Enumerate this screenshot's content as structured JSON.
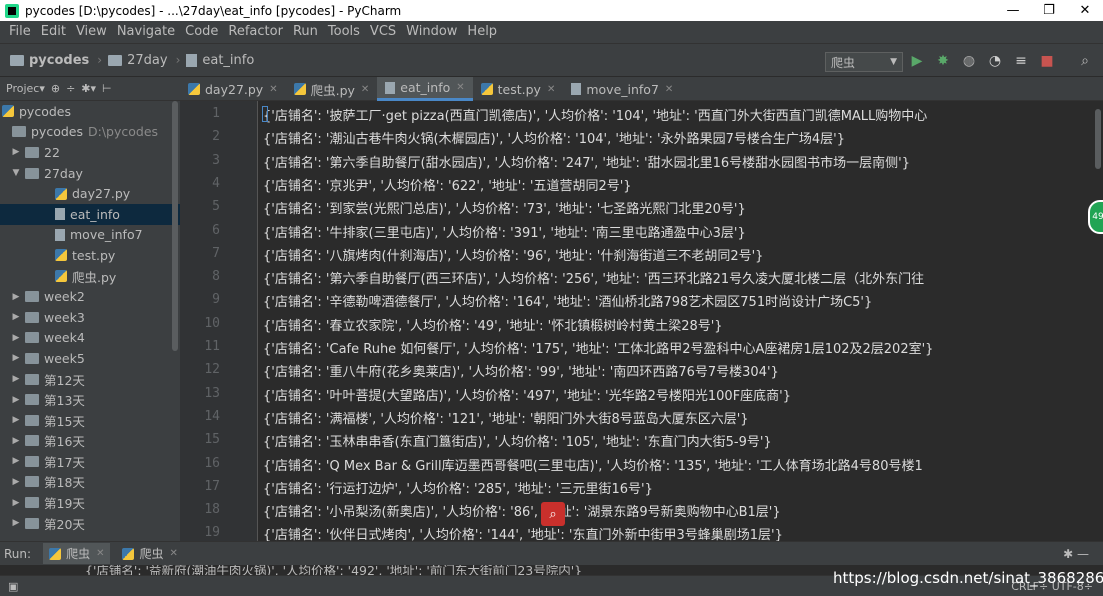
{
  "window": {
    "title": "pycodes [D:\\pycodes] - ...\\27day\\eat_info [pycodes] - PyCharm",
    "minimize": "—",
    "maximize": "❐",
    "close": "✕"
  },
  "menu": [
    "File",
    "Edit",
    "View",
    "Navigate",
    "Code",
    "Refactor",
    "Run",
    "Tools",
    "VCS",
    "Window",
    "Help"
  ],
  "breadcrumb": [
    "pycodes",
    "27day",
    "eat_info"
  ],
  "run_config": "爬虫",
  "project_toolbar": {
    "label": "Projec▾"
  },
  "tabs": [
    {
      "label": "day27.py",
      "icon": "python-file-icon",
      "active": false
    },
    {
      "label": "爬虫.py",
      "icon": "python-file-icon",
      "active": false
    },
    {
      "label": "eat_info",
      "icon": "text-file-icon",
      "active": true
    },
    {
      "label": "test.py",
      "icon": "python-file-icon",
      "active": false
    },
    {
      "label": "move_info7",
      "icon": "text-file-icon",
      "active": false
    }
  ],
  "tree": {
    "root": "pycodes",
    "project": {
      "label": "pycodes",
      "path": "D:\\pycodes"
    },
    "items": [
      {
        "label": "22",
        "level": 1,
        "arrow": "▶",
        "type": "folder"
      },
      {
        "label": "27day",
        "level": 1,
        "arrow": "▼",
        "type": "folder"
      },
      {
        "label": "day27.py",
        "level": 2,
        "type": "python"
      },
      {
        "label": "eat_info",
        "level": 2,
        "type": "text",
        "selected": true
      },
      {
        "label": "move_info7",
        "level": 2,
        "type": "text"
      },
      {
        "label": "test.py",
        "level": 2,
        "type": "python"
      },
      {
        "label": "爬虫.py",
        "level": 2,
        "type": "python"
      },
      {
        "label": "week2",
        "level": 1,
        "arrow": "▶",
        "type": "folder"
      },
      {
        "label": "week3",
        "level": 1,
        "arrow": "▶",
        "type": "folder"
      },
      {
        "label": "week4",
        "level": 1,
        "arrow": "▶",
        "type": "folder"
      },
      {
        "label": "week5",
        "level": 1,
        "arrow": "▶",
        "type": "folder"
      },
      {
        "label": "第12天",
        "level": 1,
        "arrow": "▶",
        "type": "folder"
      },
      {
        "label": "第13天",
        "level": 1,
        "arrow": "▶",
        "type": "folder"
      },
      {
        "label": "第15天",
        "level": 1,
        "arrow": "▶",
        "type": "folder"
      },
      {
        "label": "第16天",
        "level": 1,
        "arrow": "▶",
        "type": "folder"
      },
      {
        "label": "第17天",
        "level": 1,
        "arrow": "▶",
        "type": "folder"
      },
      {
        "label": "第18天",
        "level": 1,
        "arrow": "▶",
        "type": "folder"
      },
      {
        "label": "第19天",
        "level": 1,
        "arrow": "▶",
        "type": "folder"
      },
      {
        "label": "第20天",
        "level": 1,
        "arrow": "▶",
        "type": "folder"
      }
    ]
  },
  "code_lines": [
    "{'店铺名': '披萨工厂·get pizza(西直门凯德店)', '人均价格': '104', '地址': '西直门外大街西直门凯德MALL购物中心",
    "{'店铺名': '潮汕古巷牛肉火锅(木樨园店)', '人均价格': '104', '地址': '永外路果园7号楼合生广场4层'}",
    "{'店铺名': '第六季自助餐厅(甜水园店)', '人均价格': '247', '地址': '甜水园北里16号楼甜水园图书市场一层南侧'}",
    "{'店铺名': '京兆尹', '人均价格': '622', '地址': '五道营胡同2号'}",
    "{'店铺名': '到家尝(光熙门总店)', '人均价格': '73', '地址': '七圣路光熙门北里20号'}",
    "{'店铺名': '牛排家(三里屯店)', '人均价格': '391', '地址': '南三里屯路通盈中心3层'}",
    "{'店铺名': '八旗烤肉(什刹海店)', '人均价格': '96', '地址': '什刹海街道三不老胡同2号'}",
    "{'店铺名': '第六季自助餐厅(西三环店)', '人均价格': '256', '地址': '西三环北路21号久凌大厦北楼二层（北外东门往",
    "{'店铺名': '辛德勒啤酒德餐厅', '人均价格': '164', '地址': '酒仙桥北路798艺术园区751时尚设计广场C5'}",
    "{'店铺名': '春立农家院', '人均价格': '49', '地址': '怀北镇椴树岭村黄土梁28号'}",
    "{'店铺名': 'Cafe Ruhe 如何餐厅', '人均价格': '175', '地址': '工体北路甲2号盈科中心A座裙房1层102及2层202室'}",
    "{'店铺名': '重八牛府(花乡奥莱店)', '人均价格': '99', '地址': '南四环西路76号7号楼304'}",
    "{'店铺名': '叶叶菩提(大望路店)', '人均价格': '497', '地址': '光华路2号楼阳光100F座底商'}",
    "{'店铺名': '满福楼', '人均价格': '121', '地址': '朝阳门外大街8号蓝岛大厦东区六层'}",
    "{'店铺名': '玉林串串香(东直门簋街店)', '人均价格': '105', '地址': '东直门内大街5-9号'}",
    "{'店铺名': 'Q Mex Bar & Grill库迈墨西哥餐吧(三里屯店)', '人均价格': '135', '地址': '工人体育场北路4号80号楼1",
    "{'店铺名': '行运打边炉', '人均价格': '285', '地址': '三元里街16号'}",
    "{'店铺名': '小吊梨汤(新奥店)', '人均价格': '86', '地址': '湖景东路9号新奥购物中心B1层'}",
    "{'店铺名': '伙伴日式烤肉', '人均价格': '144', '地址': '东直门外新中街甲3号蜂巢剧场1层'}"
  ],
  "run": {
    "label": "Run:",
    "tabs": [
      "爬虫",
      "爬虫"
    ],
    "output_partial": "{'店铺名': '益新府(潮油牛肉火锅)', '人均价格': '492', '地址': '前门东大街前门23号院内'}"
  },
  "status": {
    "right": "CRLF÷  UTF-8÷"
  },
  "watermark": "https://blog.csdn.net/sinat_38682860",
  "badge": "49"
}
